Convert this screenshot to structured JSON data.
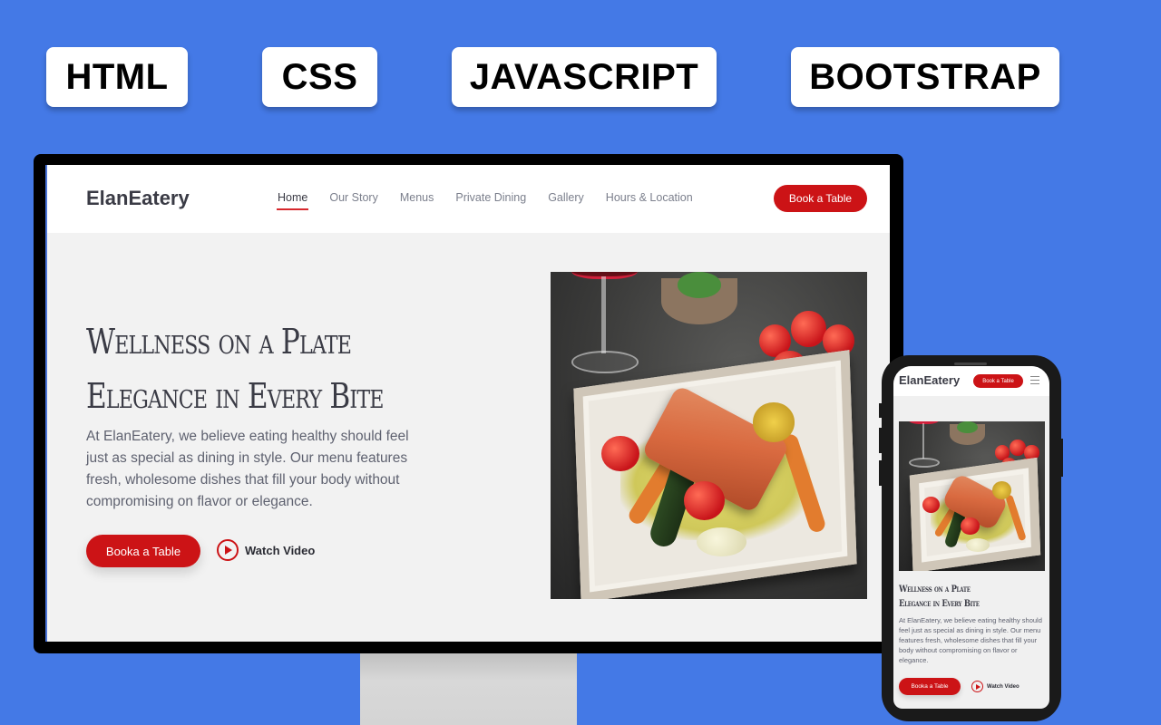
{
  "badges": [
    "HTML",
    "CSS",
    "JAVASCRIPT",
    "BOOTSTRAP"
  ],
  "site": {
    "brand": "ElanEatery",
    "nav": [
      {
        "label": "Home",
        "active": true
      },
      {
        "label": "Our Story",
        "active": false
      },
      {
        "label": "Menus",
        "active": false
      },
      {
        "label": "Private Dining",
        "active": false
      },
      {
        "label": "Gallery",
        "active": false
      },
      {
        "label": "Hours & Location",
        "active": false
      }
    ],
    "nav_cta": "Book a Table",
    "hero": {
      "title_line1": "Wellness on a Plate",
      "title_line2": "Elegance in Every Bite",
      "text": "At ElanEatery, we believe eating healthy should feel just as special as dining in style. Our menu features fresh, wholesome dishes that fill your body without compromising on flavor or elegance.",
      "primary_button": "Booka a Table",
      "video_link": "Watch Video",
      "image_alt": "Grilled salmon with roasted vegetables on an ornate plate"
    }
  },
  "colors": {
    "background": "#4479e6",
    "accent": "#cc1316",
    "text_dark": "#3a3b45",
    "text_muted": "#5f6270"
  }
}
